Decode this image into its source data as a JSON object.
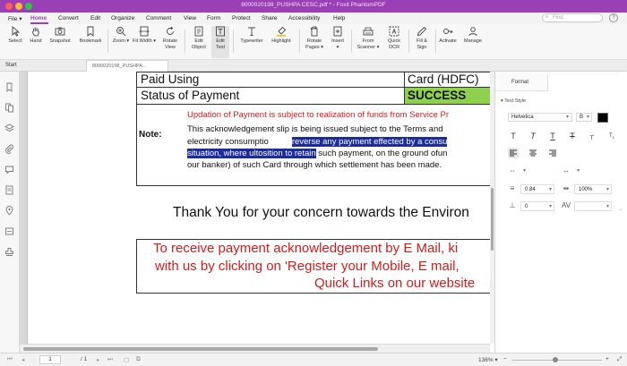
{
  "window": {
    "title": "8000020198_PUSHPA CESC.pdf * - Foxit PhantomPDF"
  },
  "menu": {
    "file": "File",
    "items": [
      "Home",
      "Convert",
      "Edit",
      "Organize",
      "Comment",
      "View",
      "Form",
      "Protect",
      "Share",
      "Accessibility",
      "Help"
    ],
    "search_placeholder": "Find"
  },
  "toolbar": {
    "tools": [
      "Select",
      "Hand",
      "Snapshot",
      "Bookmark",
      "Zoom",
      "Fit Width",
      "Rotate View",
      "Edit Object",
      "Edit Text",
      "Typewriter",
      "Highlight",
      "Rotate Pages",
      "Insert",
      "From Scanner",
      "Quick OCR",
      "Fill & Sign",
      "Activate",
      "Manage"
    ],
    "selected": "Edit Text"
  },
  "tabs": {
    "start": "Start",
    "document": "8000020198_PUSHPA..."
  },
  "document": {
    "row1": {
      "left": "Paid Using",
      "right": "Card (HDFC)"
    },
    "row2": {
      "left": "Status of Payment",
      "right": "SUCCESS"
    },
    "note_label": "Note:",
    "note_red": "Updation of Payment is subject to realization of funds from Service Pr",
    "note_line1": "This acknowledgement slip is being issued subject to the Terms and",
    "note_line2_a": "electricity consumptio",
    "note_line2_sel": "reverse any payment effected by a consu",
    "note_line3_sel": "situation, where ultosition to retain",
    "note_line3_b": " such payment, on the ground ofun",
    "note_line4": "our banker) of such Card through which settlement has been made.",
    "thanks": "Thank You for your concern towards the Environ",
    "promo1": "To receive payment acknowledgement by E Mail, ki",
    "promo2": "with us by clicking on 'Register your Mobile, E mail,",
    "promo3": "Quick Links on our website"
  },
  "format_panel": {
    "tab": "Format",
    "section": "Text Style",
    "font": "Helvetica",
    "font_style": "B",
    "line_spacing": "0.84",
    "scale": "100%",
    "offset": "0",
    "text_color": "#000000"
  },
  "status": {
    "page": "1",
    "total": "/ 1",
    "zoom": "136%"
  },
  "colors": {
    "accent": "#9b3fb6",
    "success_bg": "#8fd14f",
    "red_text": "#d21c1c",
    "selection": "#1d2c9c"
  }
}
